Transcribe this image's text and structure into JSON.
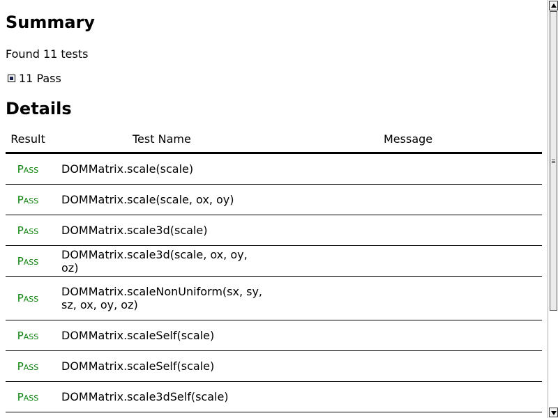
{
  "summary": {
    "title": "Summary",
    "found_text": "Found 11 tests",
    "pass_summary": "11 Pass"
  },
  "details": {
    "title": "Details",
    "columns": [
      "Result",
      "Test Name",
      "Message"
    ],
    "rows": [
      {
        "result": "Pass",
        "name": "DOMMatrix.scale(scale)",
        "message": ""
      },
      {
        "result": "Pass",
        "name": "DOMMatrix.scale(scale, ox, oy)",
        "message": ""
      },
      {
        "result": "Pass",
        "name": "DOMMatrix.scale3d(scale)",
        "message": ""
      },
      {
        "result": "Pass",
        "name": "DOMMatrix.scale3d(scale, ox, oy, oz)",
        "message": ""
      },
      {
        "result": "Pass",
        "name": "DOMMatrix.scaleNonUniform(sx, sy, sz, ox, oy, oz)",
        "message": ""
      },
      {
        "result": "Pass",
        "name": "DOMMatrix.scaleSelf(scale)",
        "message": ""
      },
      {
        "result": "Pass",
        "name": "DOMMatrix.scaleSelf(scale)",
        "message": ""
      },
      {
        "result": "Pass",
        "name": "DOMMatrix.scale3dSelf(scale)",
        "message": ""
      }
    ]
  },
  "colors": {
    "pass": "#0a820a",
    "checkbox_fill": "#1a1f4e"
  }
}
